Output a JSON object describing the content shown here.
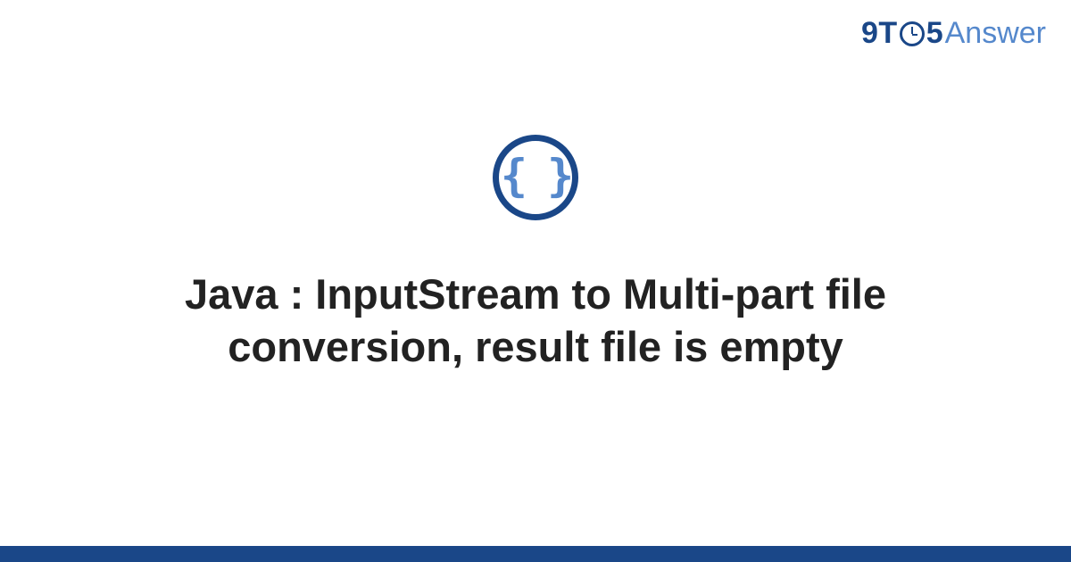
{
  "header": {
    "logo_9t": "9T",
    "logo_5": "5",
    "logo_answer": "Answer"
  },
  "icon": {
    "braces": "{ }",
    "name": "code-braces-icon"
  },
  "title": "Java : InputStream to Multi-part file conversion, result file is empty",
  "colors": {
    "primary": "#1a4788",
    "secondary": "#5588cc",
    "text": "#222222",
    "background": "#ffffff"
  }
}
